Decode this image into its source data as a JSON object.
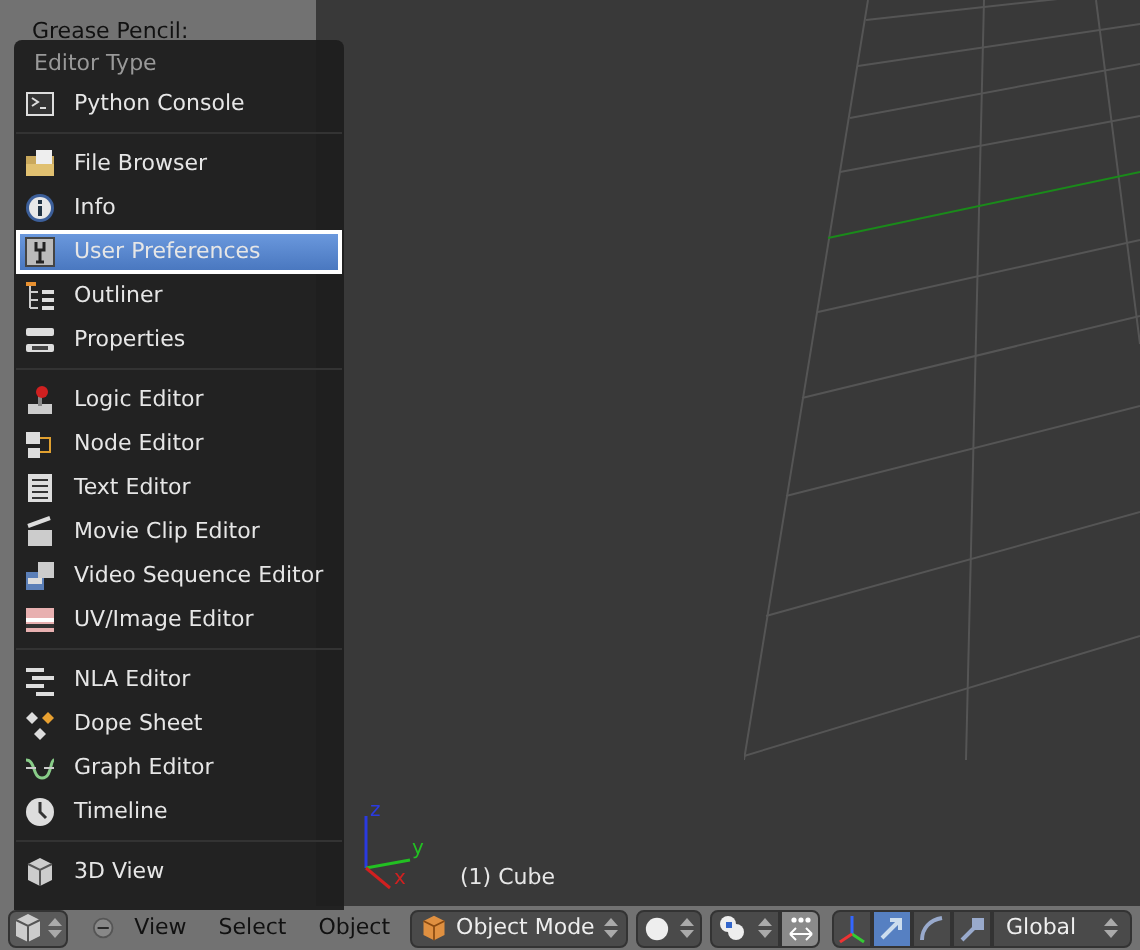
{
  "panel": {
    "title": "Grease Pencil:"
  },
  "menu": {
    "title": "Editor Type",
    "groups": [
      [
        {
          "label": "Python Console",
          "selected": false
        }
      ],
      [
        {
          "label": "File Browser",
          "selected": false
        },
        {
          "label": "Info",
          "selected": false
        },
        {
          "label": "User Preferences",
          "selected": true
        },
        {
          "label": "Outliner",
          "selected": false
        },
        {
          "label": "Properties",
          "selected": false
        }
      ],
      [
        {
          "label": "Logic Editor",
          "selected": false
        },
        {
          "label": "Node Editor",
          "selected": false
        },
        {
          "label": "Text Editor",
          "selected": false
        },
        {
          "label": "Movie Clip Editor",
          "selected": false
        },
        {
          "label": "Video Sequence Editor",
          "selected": false
        },
        {
          "label": "UV/Image Editor",
          "selected": false
        }
      ],
      [
        {
          "label": "NLA Editor",
          "selected": false
        },
        {
          "label": "Dope Sheet",
          "selected": false
        },
        {
          "label": "Graph Editor",
          "selected": false
        },
        {
          "label": "Timeline",
          "selected": false
        }
      ],
      [
        {
          "label": "3D View",
          "selected": false
        }
      ]
    ]
  },
  "viewport": {
    "object_label": "(1) Cube",
    "axes": {
      "x": "x",
      "y": "y",
      "z": "z"
    }
  },
  "header": {
    "menus": [
      "View",
      "Select",
      "Object"
    ],
    "mode": "Object Mode",
    "orientation": "Global",
    "manipulators": [
      {
        "kind": "translate",
        "selected": true
      },
      {
        "kind": "rotate",
        "selected": false
      },
      {
        "kind": "scale",
        "selected": false
      }
    ]
  }
}
